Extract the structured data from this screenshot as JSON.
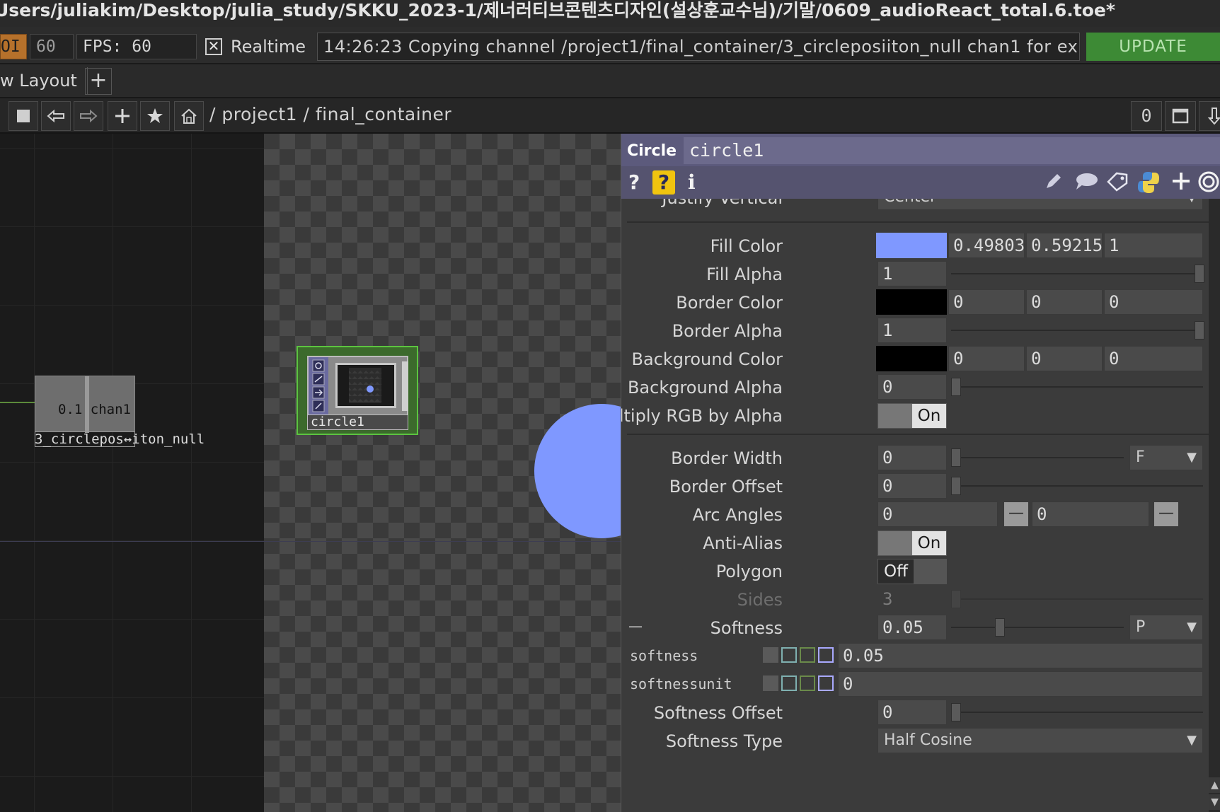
{
  "window": {
    "title": "Users/juliakim/Desktop/julia_study/SKKU_2023-1/제너러티브콘텐츠디자인(설상훈교수님)/기말/0609_audioReact_total.6.toe*"
  },
  "perf": {
    "oi_label": "OI",
    "cook_value": "60",
    "fps_label": "FPS:  60",
    "realtime_check": "✕",
    "realtime_label": "Realtime",
    "status": "14:26:23 Copying channel /project1/final_container/3_circleposiiton_null chan1 for export",
    "update_label": "UPDATE"
  },
  "layout": {
    "tab_label": "w Layout",
    "add_label": "+"
  },
  "nav": {
    "path": "/  project1  /  final_container",
    "right_value": "0"
  },
  "network": {
    "null_node_text": "0.1 chan1",
    "null_node_name": "3_circlepos↔iton_null",
    "circle_node_name": "circle1"
  },
  "panel": {
    "op_type": "Circle",
    "op_name": "circle1",
    "tools": {
      "help": "?",
      "help2": "?",
      "info": "i"
    },
    "params": {
      "justify_vertical": {
        "label": "Justify Vertical",
        "value": "Center"
      },
      "fill_color": {
        "label": "Fill Color",
        "r": "0.49803",
        "g": "0.59215",
        "b": "1",
        "swatch": "#7f98ff"
      },
      "fill_alpha": {
        "label": "Fill Alpha",
        "value": "1"
      },
      "border_color": {
        "label": "Border Color",
        "r": "0",
        "g": "0",
        "b": "0",
        "swatch": "#000000"
      },
      "border_alpha": {
        "label": "Border Alpha",
        "value": "1"
      },
      "background_color": {
        "label": "Background Color",
        "r": "0",
        "g": "0",
        "b": "0",
        "swatch": "#000000"
      },
      "background_alpha": {
        "label": "Background Alpha",
        "value": "0"
      },
      "premultiply": {
        "label": "Pre-Multiply RGB by Alpha",
        "value": "On"
      },
      "border_width": {
        "label": "Border Width",
        "value": "0",
        "unit": "F"
      },
      "border_offset": {
        "label": "Border Offset",
        "value": "0"
      },
      "arc_angles": {
        "label": "Arc Angles",
        "v1": "0",
        "v2": "0",
        "btn": "—"
      },
      "anti_alias": {
        "label": "Anti-Alias",
        "value": "On"
      },
      "polygon": {
        "label": "Polygon",
        "value": "Off"
      },
      "sides": {
        "label": "Sides",
        "value": "3"
      },
      "softness": {
        "label": "Softness",
        "value": "0.05",
        "unit": "P",
        "collapse": "—"
      },
      "softness_expr": {
        "label": "softness",
        "value": "0.05"
      },
      "softnessunit_expr": {
        "label": "softnessunit",
        "value": "0"
      },
      "softness_offset": {
        "label": "Softness Offset",
        "value": "0"
      },
      "softness_type": {
        "label": "Softness Type",
        "value": "Half Cosine"
      }
    }
  }
}
